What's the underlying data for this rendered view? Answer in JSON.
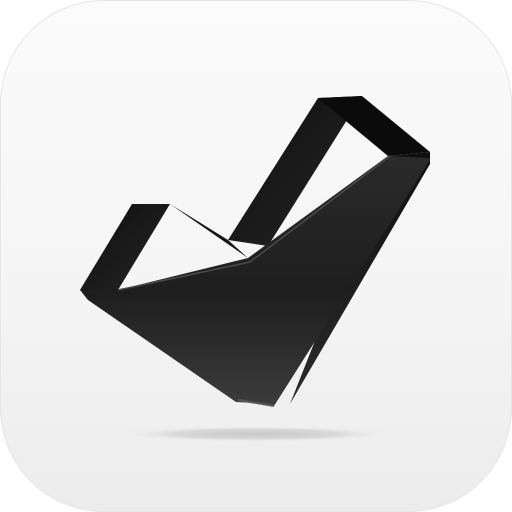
{
  "app_icon": {
    "icon": "checkmark-icon",
    "background_color": "#f5f5f5",
    "mark_color": "#1c1c1c"
  }
}
